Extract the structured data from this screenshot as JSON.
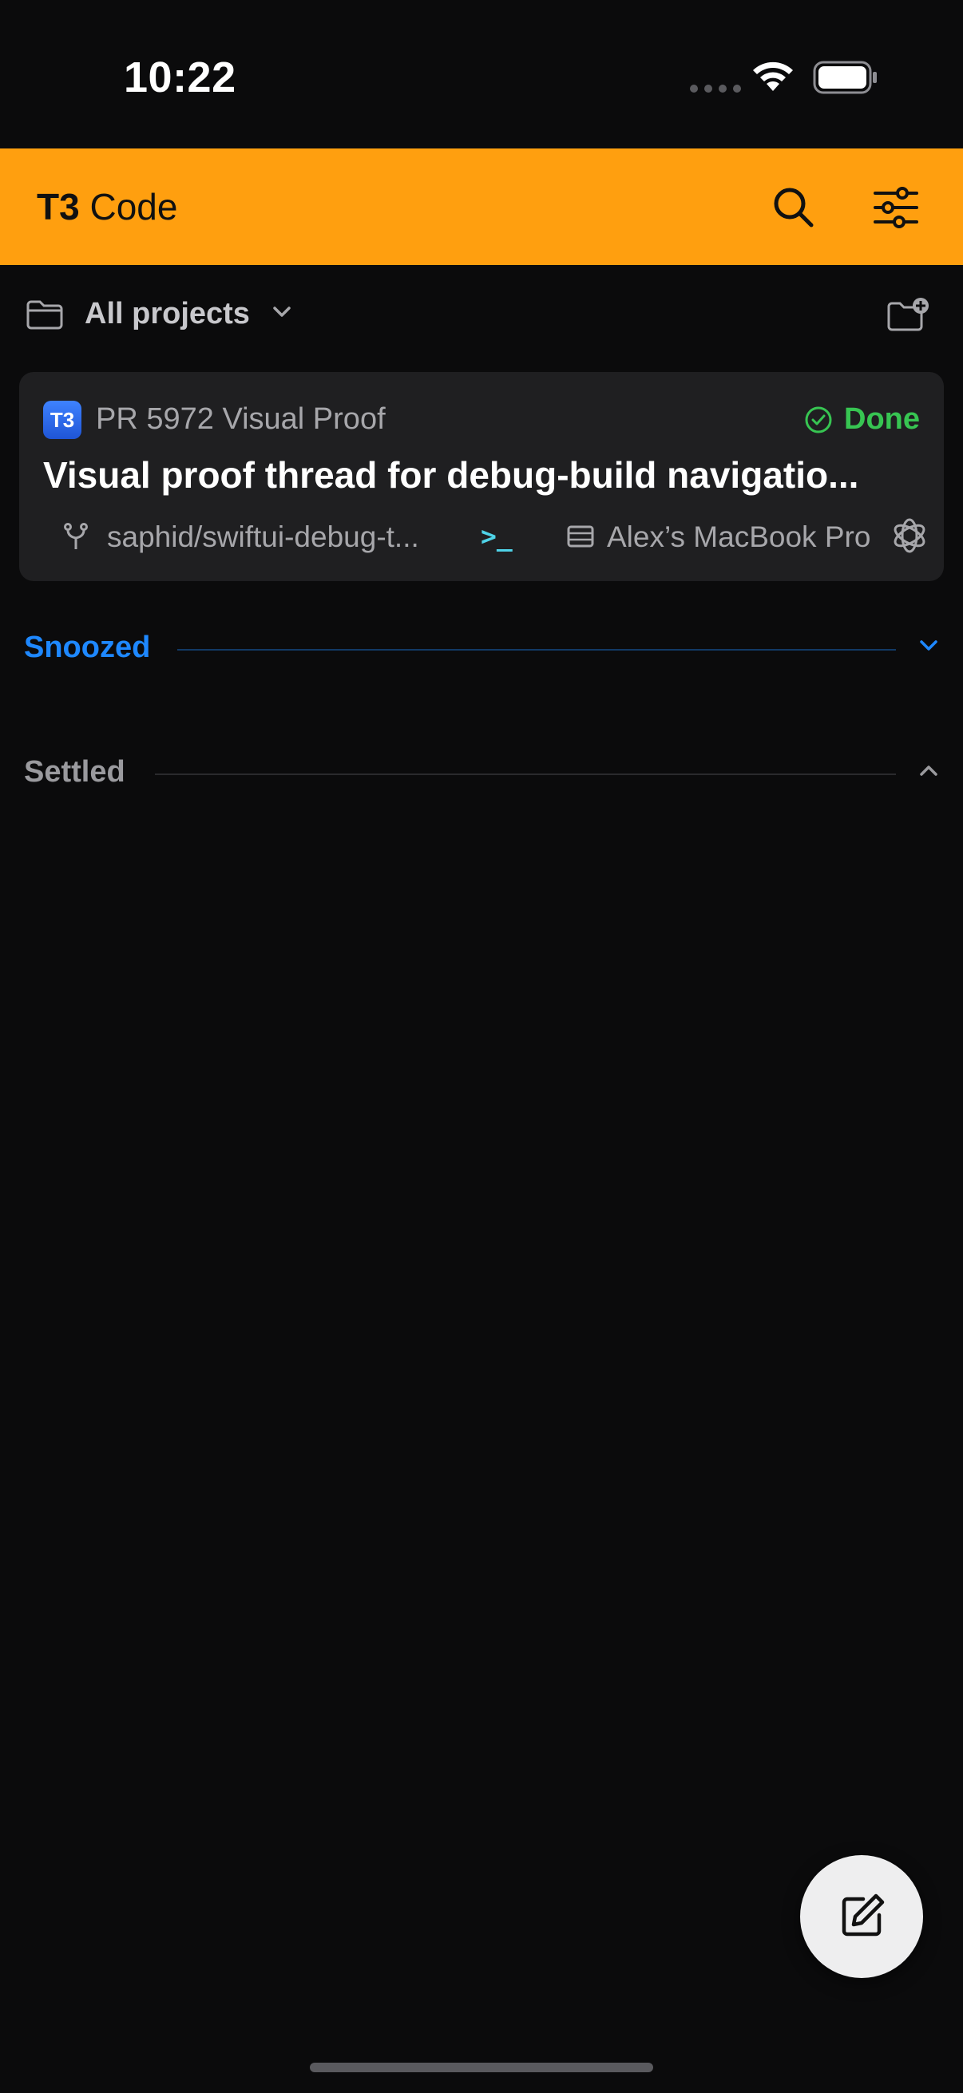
{
  "status_bar": {
    "time": "10:22"
  },
  "header": {
    "title_bold": "T3",
    "title_rest": " Code",
    "accent_color": "#ff9f0f"
  },
  "project_bar": {
    "label": "All projects"
  },
  "thread": {
    "badge": "T3",
    "project": "PR 5972 Visual Proof",
    "status": "Done",
    "title": "Visual proof thread for debug-build navigatio...",
    "branch": "saphid/swiftui-debug-t...",
    "terminal_glyph": ">_",
    "machine": "Alex’s MacBook Pro"
  },
  "sections": {
    "snoozed": {
      "label": "Snoozed",
      "color": "#1e88ff"
    },
    "settled": {
      "label": "Settled"
    }
  },
  "icons": [
    "wifi-icon",
    "battery-icon",
    "search-icon",
    "filter-icon",
    "folder-icon",
    "chevron-down-icon",
    "new-folder-icon",
    "check-circle-icon",
    "branch-icon",
    "terminal-icon",
    "server-icon",
    "openai-icon",
    "chevron-up-icon",
    "compose-icon"
  ]
}
